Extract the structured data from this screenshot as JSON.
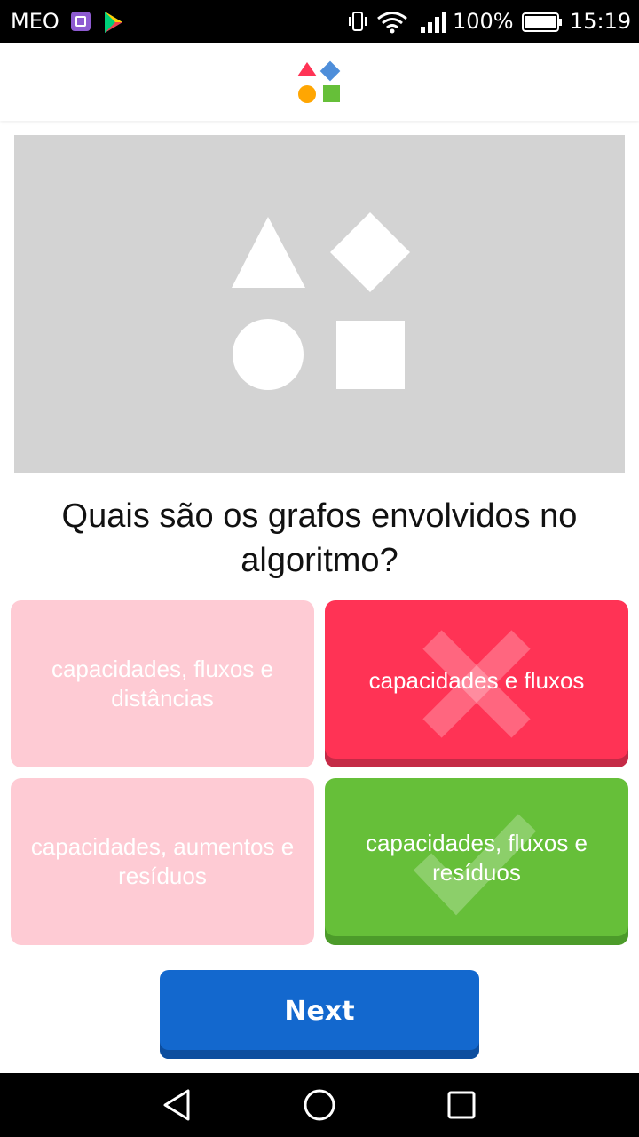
{
  "status_bar": {
    "carrier": "MEO",
    "battery": "100%",
    "time": "15:19",
    "icons": [
      "gallery-icon",
      "play-store-icon",
      "vibrate-icon",
      "wifi-icon",
      "signal-icon",
      "battery-icon"
    ]
  },
  "header": {
    "logo_icon": "shapes-logo-icon"
  },
  "question": {
    "image_icon": "shapes-placeholder-icon",
    "text": "Quais são os grafos envolvidos no algoritmo?"
  },
  "answers": [
    {
      "label": "capacidades, fluxos e distâncias",
      "state": "dimmed"
    },
    {
      "label": "capacidades e fluxos",
      "state": "selected-wrong",
      "mark": "cross-icon"
    },
    {
      "label": "capacidades, aumentos e resíduos",
      "state": "dimmed"
    },
    {
      "label": "capacidades, fluxos e resíduos",
      "state": "correct",
      "mark": "check-icon"
    }
  ],
  "next_button": {
    "label": "Next"
  },
  "colors": {
    "red": "#ff3355",
    "blue": "#1368ce",
    "yellow": "#ffa602",
    "green": "#66bf39",
    "dimmed": "#fecbd4"
  },
  "nav_bar": {
    "icons": [
      "back-icon",
      "home-icon",
      "recent-apps-icon"
    ]
  }
}
